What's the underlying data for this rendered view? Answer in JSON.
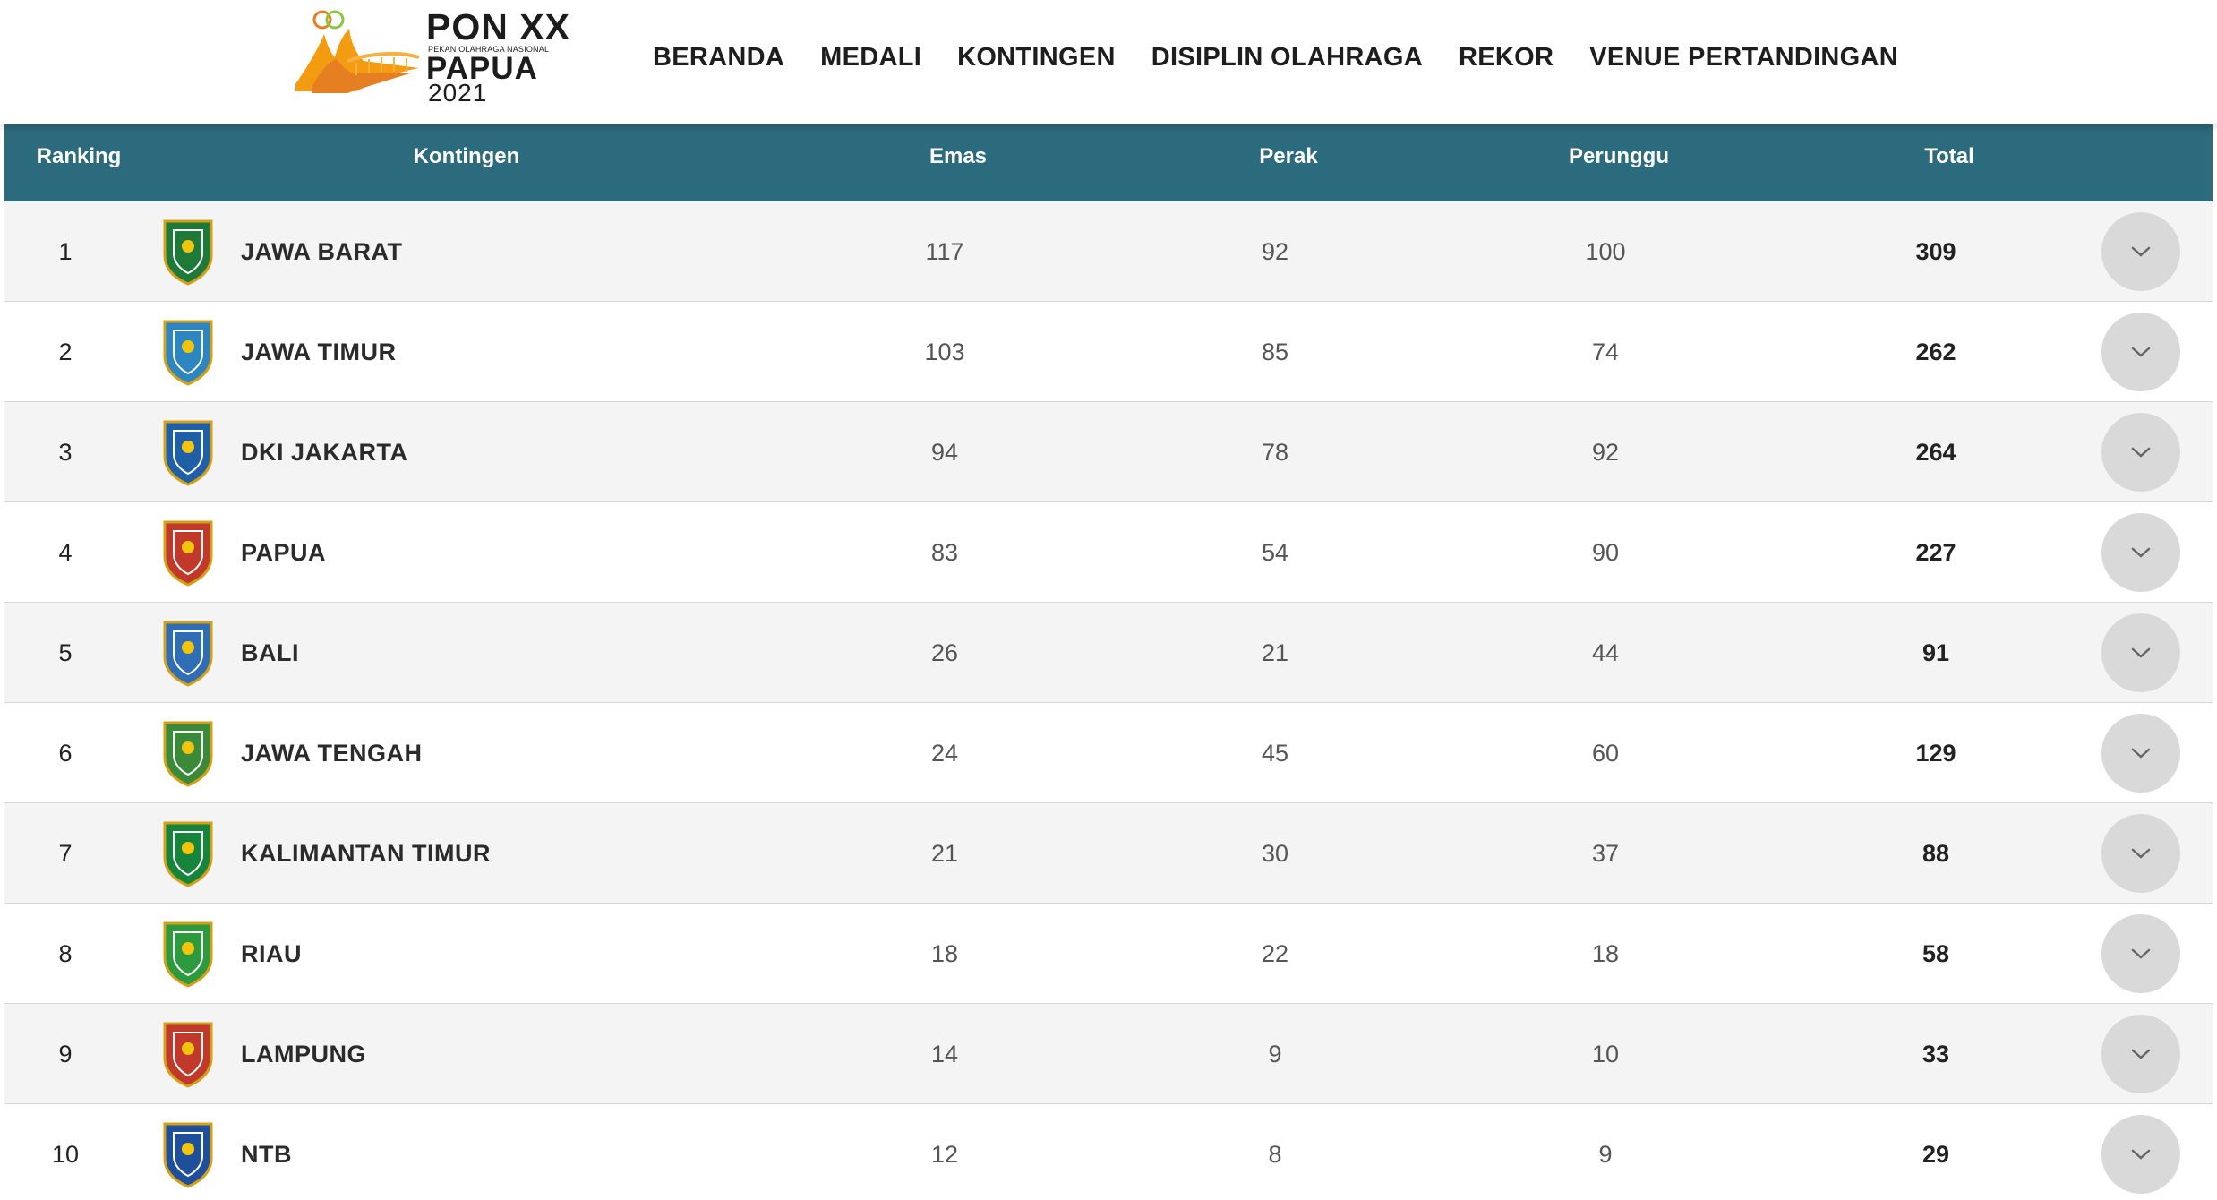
{
  "header": {
    "logo": {
      "pon": "PON XX",
      "subtitle": "PEKAN OLAHRAGA NASIONAL",
      "papua": "PAPUA",
      "year": "2021"
    },
    "nav": [
      "BERANDA",
      "MEDALI",
      "KONTINGEN",
      "DISIPLIN OLAHRAGA",
      "REKOR",
      "VENUE PERTANDINGAN"
    ]
  },
  "table": {
    "columns": {
      "ranking": "Ranking",
      "kontingen": "Kontingen",
      "emas": "Emas",
      "perak": "Perak",
      "perunggu": "Perunggu",
      "total": "Total"
    },
    "rows": [
      {
        "rank": "1",
        "name": "JAWA BARAT",
        "emas": "117",
        "perak": "92",
        "perunggu": "100",
        "total": "309",
        "emblem_color": "#1f7a3a",
        "emblem_icon": "jawa-barat-emblem-icon"
      },
      {
        "rank": "2",
        "name": "JAWA TIMUR",
        "emas": "103",
        "perak": "85",
        "perunggu": "74",
        "total": "262",
        "emblem_color": "#2e86c1",
        "emblem_icon": "jawa-timur-emblem-icon"
      },
      {
        "rank": "3",
        "name": "DKI JAKARTA",
        "emas": "94",
        "perak": "78",
        "perunggu": "92",
        "total": "264",
        "emblem_color": "#1f5fa8",
        "emblem_icon": "dki-jakarta-emblem-icon"
      },
      {
        "rank": "4",
        "name": "PAPUA",
        "emas": "83",
        "perak": "54",
        "perunggu": "90",
        "total": "227",
        "emblem_color": "#c0392b",
        "emblem_icon": "papua-emblem-icon"
      },
      {
        "rank": "5",
        "name": "BALI",
        "emas": "26",
        "perak": "21",
        "perunggu": "44",
        "total": "91",
        "emblem_color": "#2f6db5",
        "emblem_icon": "bali-emblem-icon"
      },
      {
        "rank": "6",
        "name": "JAWA TENGAH",
        "emas": "24",
        "perak": "45",
        "perunggu": "60",
        "total": "129",
        "emblem_color": "#3a8a3a",
        "emblem_icon": "jawa-tengah-emblem-icon"
      },
      {
        "rank": "7",
        "name": "KALIMANTAN TIMUR",
        "emas": "21",
        "perak": "30",
        "perunggu": "37",
        "total": "88",
        "emblem_color": "#17843b",
        "emblem_icon": "kalimantan-timur-emblem-icon"
      },
      {
        "rank": "8",
        "name": "RIAU",
        "emas": "18",
        "perak": "22",
        "perunggu": "18",
        "total": "58",
        "emblem_color": "#2e9a3e",
        "emblem_icon": "riau-emblem-icon"
      },
      {
        "rank": "9",
        "name": "LAMPUNG",
        "emas": "14",
        "perak": "9",
        "perunggu": "10",
        "total": "33",
        "emblem_color": "#c0392b",
        "emblem_icon": "lampung-emblem-icon"
      },
      {
        "rank": "10",
        "name": "NTB",
        "emas": "12",
        "perak": "8",
        "perunggu": "9",
        "total": "29",
        "emblem_color": "#1f4f9a",
        "emblem_icon": "ntb-emblem-icon"
      }
    ]
  },
  "colors": {
    "header_bg": "#2c6b7d",
    "row_odd": "#f4f4f4",
    "row_even": "#ffffff",
    "expand_button": "#d9d9d9"
  },
  "icons": {
    "expand": "chevron-down-icon"
  }
}
